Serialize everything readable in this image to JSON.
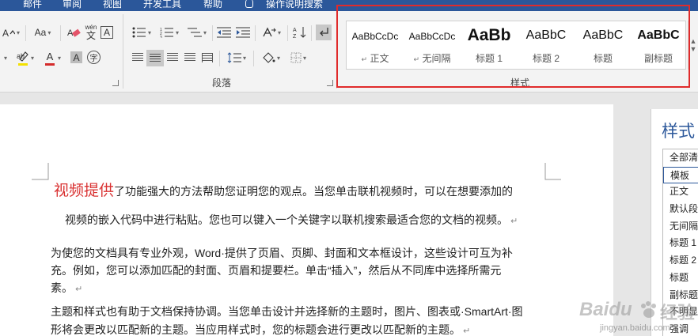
{
  "menu_tabs": [
    "邮件",
    "审阅",
    "视图",
    "开发工具",
    "帮助",
    "操作说明搜索"
  ],
  "ribbon": {
    "font_group": {
      "aa_case": "Aa",
      "wen_label": "wén",
      "wen_char": "文",
      "frame_a": "A",
      "circle_char": "字",
      "highlight_color": "#f3e100",
      "font_color": "#d42b2b"
    },
    "paragraph_group": {
      "label": "段落"
    },
    "styles_group": {
      "label": "样式",
      "items": [
        {
          "sample": "AaBbCcDc",
          "name": "正文",
          "mark": "↵"
        },
        {
          "sample": "AaBbCcDc",
          "name": "无间隔",
          "mark": "↵"
        },
        {
          "sample": "AaBb",
          "name": "标题 1",
          "mark": ""
        },
        {
          "sample": "AaBbC",
          "name": "标题 2",
          "mark": ""
        },
        {
          "sample": "AaBbC",
          "name": "标题",
          "mark": ""
        },
        {
          "sample": "AaBbC",
          "name": "副标题",
          "mark": ""
        }
      ]
    }
  },
  "document": {
    "title_text": "视频提供",
    "line1_rest": "了功能强大的方法帮助您证明您的观点。当您单击联机视频时，可以在想要添加的",
    "line2": "视频的嵌入代码中进行粘贴。您也可以键入一个关键字以联机搜索最适合您的文档的视频。",
    "para2_l1": "为使您的文档具有专业外观，Word·提供了页眉、页脚、封面和文本框设计，这些设计可互为补",
    "para2_l2": "充。例如，您可以添加匹配的封面、页眉和提要栏。单击“插入”，然后从不同库中选择所需元",
    "para2_l3": "素。",
    "para3_l1": "主题和样式也有助于文档保持协调。当您单击设计并选择新的主题时，图片、图表或·SmartArt·图",
    "para3_l2": "形将会更改以匹配新的主题。当应用样式时，您的标题会进行更改以匹配新的主题。",
    "para_mark": "↵"
  },
  "styles_pane": {
    "title": "样式",
    "items": [
      "全部清",
      "模板",
      "正文",
      "默认段",
      "无间隔",
      "标题 1",
      "标题 2",
      "标题",
      "副标题",
      "不明显",
      "强调"
    ],
    "selected_index": 1
  },
  "watermark": {
    "brand_main": "Baidu",
    "brand_suffix": "经验",
    "url": "jingyan.baidu.com"
  }
}
